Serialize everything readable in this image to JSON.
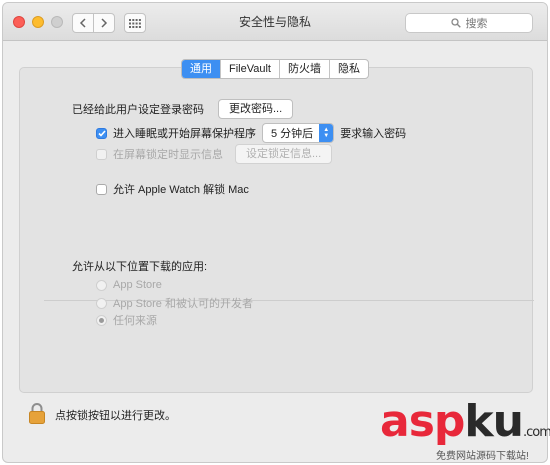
{
  "window": {
    "title": "安全性与隐私",
    "search_placeholder": "搜索"
  },
  "tabs": [
    {
      "label": "通用",
      "active": true
    },
    {
      "label": "FileVault",
      "active": false
    },
    {
      "label": "防火墙",
      "active": false
    },
    {
      "label": "隐私",
      "active": false
    }
  ],
  "general": {
    "password_label": "已经给此用户设定登录密码",
    "change_password_button": "更改密码...",
    "sleep_checkbox_label": "进入睡眠或开始屏幕保护程序",
    "sleep_checkbox_checked": true,
    "sleep_delay_value": "5 分钟后",
    "require_password_label": "要求输入密码",
    "lock_message_checkbox_label": "在屏幕锁定时显示信息",
    "lock_message_button": "设定锁定信息...",
    "watch_checkbox_label": "允许 Apple Watch 解锁 Mac",
    "watch_checkbox_checked": false
  },
  "downloads": {
    "heading": "允许从以下位置下载的应用:",
    "options": [
      {
        "label": "App Store",
        "selected": false
      },
      {
        "label": "App Store 和被认可的开发者",
        "selected": false
      },
      {
        "label": "任何来源",
        "selected": true
      }
    ]
  },
  "footer": {
    "lock_text": "点按锁按钮以进行更改。"
  },
  "watermark": {
    "brand_red": "asp",
    "brand_dark": "ku",
    "suffix": ".com",
    "tagline": "免费网站源码下载站!"
  },
  "colors": {
    "accent": "#3d8ff2",
    "watermark_red": "#e8283a"
  }
}
